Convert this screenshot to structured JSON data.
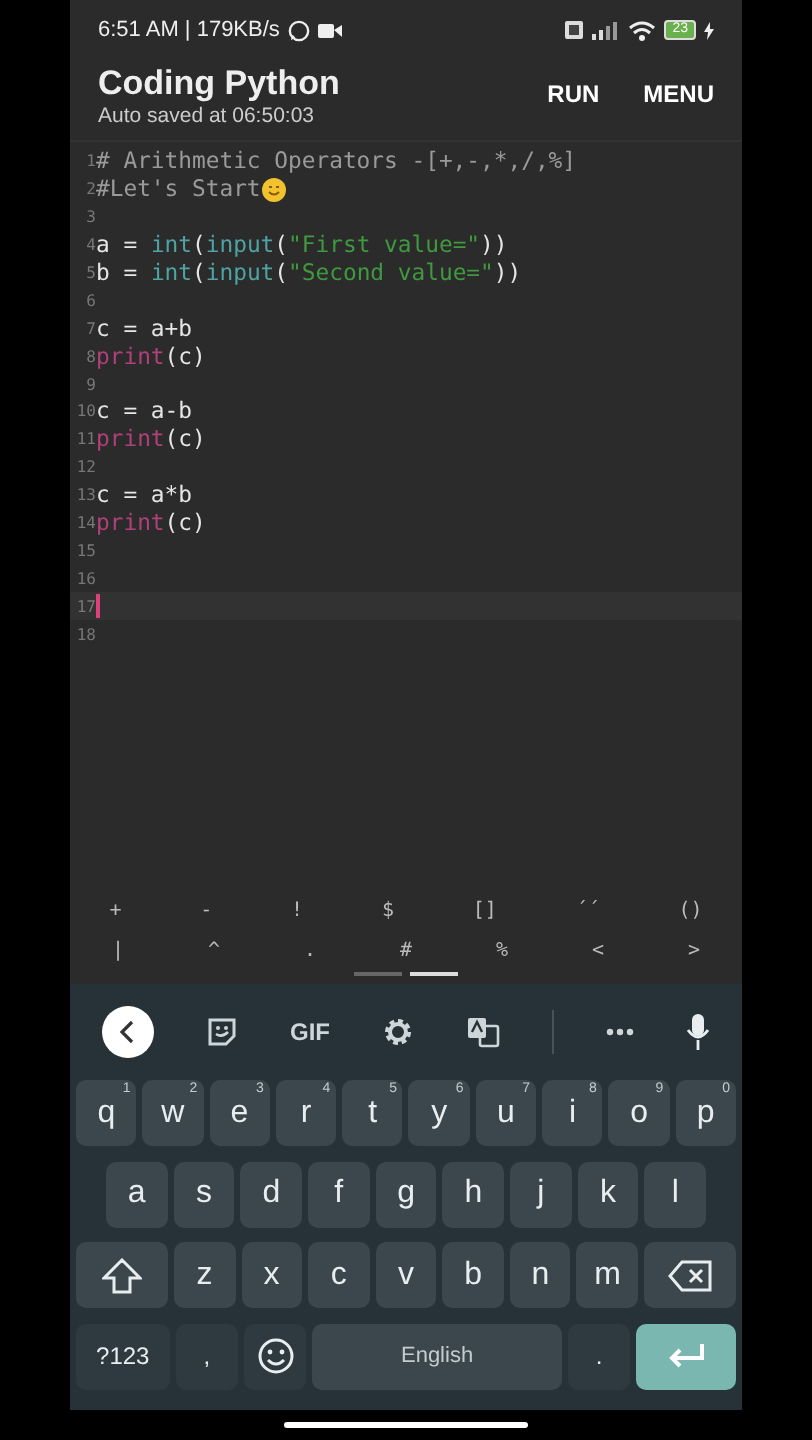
{
  "status_bar": {
    "time_speed": "6:51 AM | 179KB/s",
    "battery_text": "23"
  },
  "app_bar": {
    "title": "Coding Python",
    "subtitle": "Auto saved at 06:50:03",
    "actions": [
      "RUN",
      "MENU"
    ]
  },
  "editor": {
    "lines": [
      {
        "number": "1",
        "current": false,
        "tokens": [
          {
            "kind": "comment",
            "text": "# Arithmetic Operators -[+,-,*,/,%]"
          }
        ]
      },
      {
        "number": "2",
        "current": false,
        "emoji": true,
        "tokens": [
          {
            "kind": "comment",
            "text": "#Let's Start"
          }
        ]
      },
      {
        "number": "3",
        "current": false
      },
      {
        "number": "4",
        "current": false,
        "tokens": [
          {
            "kind": "plain",
            "text": "a = "
          },
          {
            "kind": "builtin",
            "text": "int"
          },
          {
            "kind": "plain",
            "text": "("
          },
          {
            "kind": "builtin",
            "text": "input"
          },
          {
            "kind": "plain",
            "text": "("
          },
          {
            "kind": "string",
            "text": "\"First value=\""
          },
          {
            "kind": "plain",
            "text": "))"
          }
        ]
      },
      {
        "number": "5",
        "current": false,
        "tokens": [
          {
            "kind": "plain",
            "text": "b = "
          },
          {
            "kind": "builtin",
            "text": "int"
          },
          {
            "kind": "plain",
            "text": "("
          },
          {
            "kind": "builtin",
            "text": "input"
          },
          {
            "kind": "plain",
            "text": "("
          },
          {
            "kind": "string",
            "text": "\"Second value=\""
          },
          {
            "kind": "plain",
            "text": "))"
          }
        ]
      },
      {
        "number": "6",
        "current": false
      },
      {
        "number": "7",
        "current": false,
        "tokens": [
          {
            "kind": "plain",
            "text": "c = a+b"
          }
        ]
      },
      {
        "number": "8",
        "current": false,
        "tokens": [
          {
            "kind": "keyword",
            "text": "print"
          },
          {
            "kind": "plain",
            "text": "(c)"
          }
        ]
      },
      {
        "number": "9",
        "current": false
      },
      {
        "number": "10",
        "current": false,
        "tokens": [
          {
            "kind": "plain",
            "text": "c = a-b"
          }
        ]
      },
      {
        "number": "11",
        "current": false,
        "tokens": [
          {
            "kind": "keyword",
            "text": "print"
          },
          {
            "kind": "plain",
            "text": "(c)"
          }
        ]
      },
      {
        "number": "12",
        "current": false
      },
      {
        "number": "13",
        "current": false,
        "tokens": [
          {
            "kind": "plain",
            "text": "c = a*b"
          }
        ]
      },
      {
        "number": "14",
        "current": false,
        "tokens": [
          {
            "kind": "keyword",
            "text": "print"
          },
          {
            "kind": "plain",
            "text": "(c)"
          }
        ]
      },
      {
        "number": "15",
        "current": false
      },
      {
        "number": "16",
        "current": false
      },
      {
        "number": "17",
        "current": true
      },
      {
        "number": "18",
        "current": false
      }
    ]
  },
  "symbol_bar": {
    "rows": [
      [
        "+",
        "-",
        "!",
        "$",
        "[]",
        "´´",
        "()"
      ],
      [
        "|",
        "^",
        ".",
        "#",
        "%",
        "<",
        ">"
      ]
    ],
    "pages": [
      {
        "selected": false
      },
      {
        "selected": true
      }
    ]
  },
  "keyboard": {
    "toolbar": {
      "gif": "GIF"
    },
    "key_lines": {
      "numbers_line": [
        {
          "kind": "letter",
          "label": "q",
          "hint": "1"
        },
        {
          "kind": "letter",
          "label": "w",
          "hint": "2"
        },
        {
          "kind": "letter",
          "label": "e",
          "hint": "3"
        },
        {
          "kind": "letter",
          "label": "r",
          "hint": "4"
        },
        {
          "kind": "letter",
          "label": "t",
          "hint": "5"
        },
        {
          "kind": "letter",
          "label": "y",
          "hint": "6"
        },
        {
          "kind": "letter",
          "label": "u",
          "hint": "7"
        },
        {
          "kind": "letter",
          "label": "i",
          "hint": "8"
        },
        {
          "kind": "letter",
          "label": "o",
          "hint": "9"
        },
        {
          "kind": "letter",
          "label": "p",
          "hint": "0"
        }
      ],
      "middle_line": [
        {
          "kind": "letter",
          "label": "a"
        },
        {
          "kind": "letter",
          "label": "s"
        },
        {
          "kind": "letter",
          "label": "d"
        },
        {
          "kind": "letter",
          "label": "f"
        },
        {
          "kind": "letter",
          "label": "g"
        },
        {
          "kind": "letter",
          "label": "h"
        },
        {
          "kind": "letter",
          "label": "j"
        },
        {
          "kind": "letter",
          "label": "k"
        },
        {
          "kind": "letter",
          "label": "l"
        }
      ],
      "shift_line": [
        {
          "kind": "shift"
        },
        {
          "kind": "letter",
          "label": "z"
        },
        {
          "kind": "letter",
          "label": "x"
        },
        {
          "kind": "letter",
          "label": "c"
        },
        {
          "kind": "letter",
          "label": "v"
        },
        {
          "kind": "letter",
          "label": "b"
        },
        {
          "kind": "letter",
          "label": "n"
        },
        {
          "kind": "letter",
          "label": "m"
        },
        {
          "kind": "backspace"
        }
      ],
      "space_line": [
        {
          "kind": "symbols",
          "label": "?123"
        },
        {
          "kind": "dark",
          "label": ","
        },
        {
          "kind": "emoji"
        },
        {
          "kind": "space",
          "label": "English"
        },
        {
          "kind": "dark",
          "label": "."
        },
        {
          "kind": "enter"
        }
      ]
    }
  }
}
